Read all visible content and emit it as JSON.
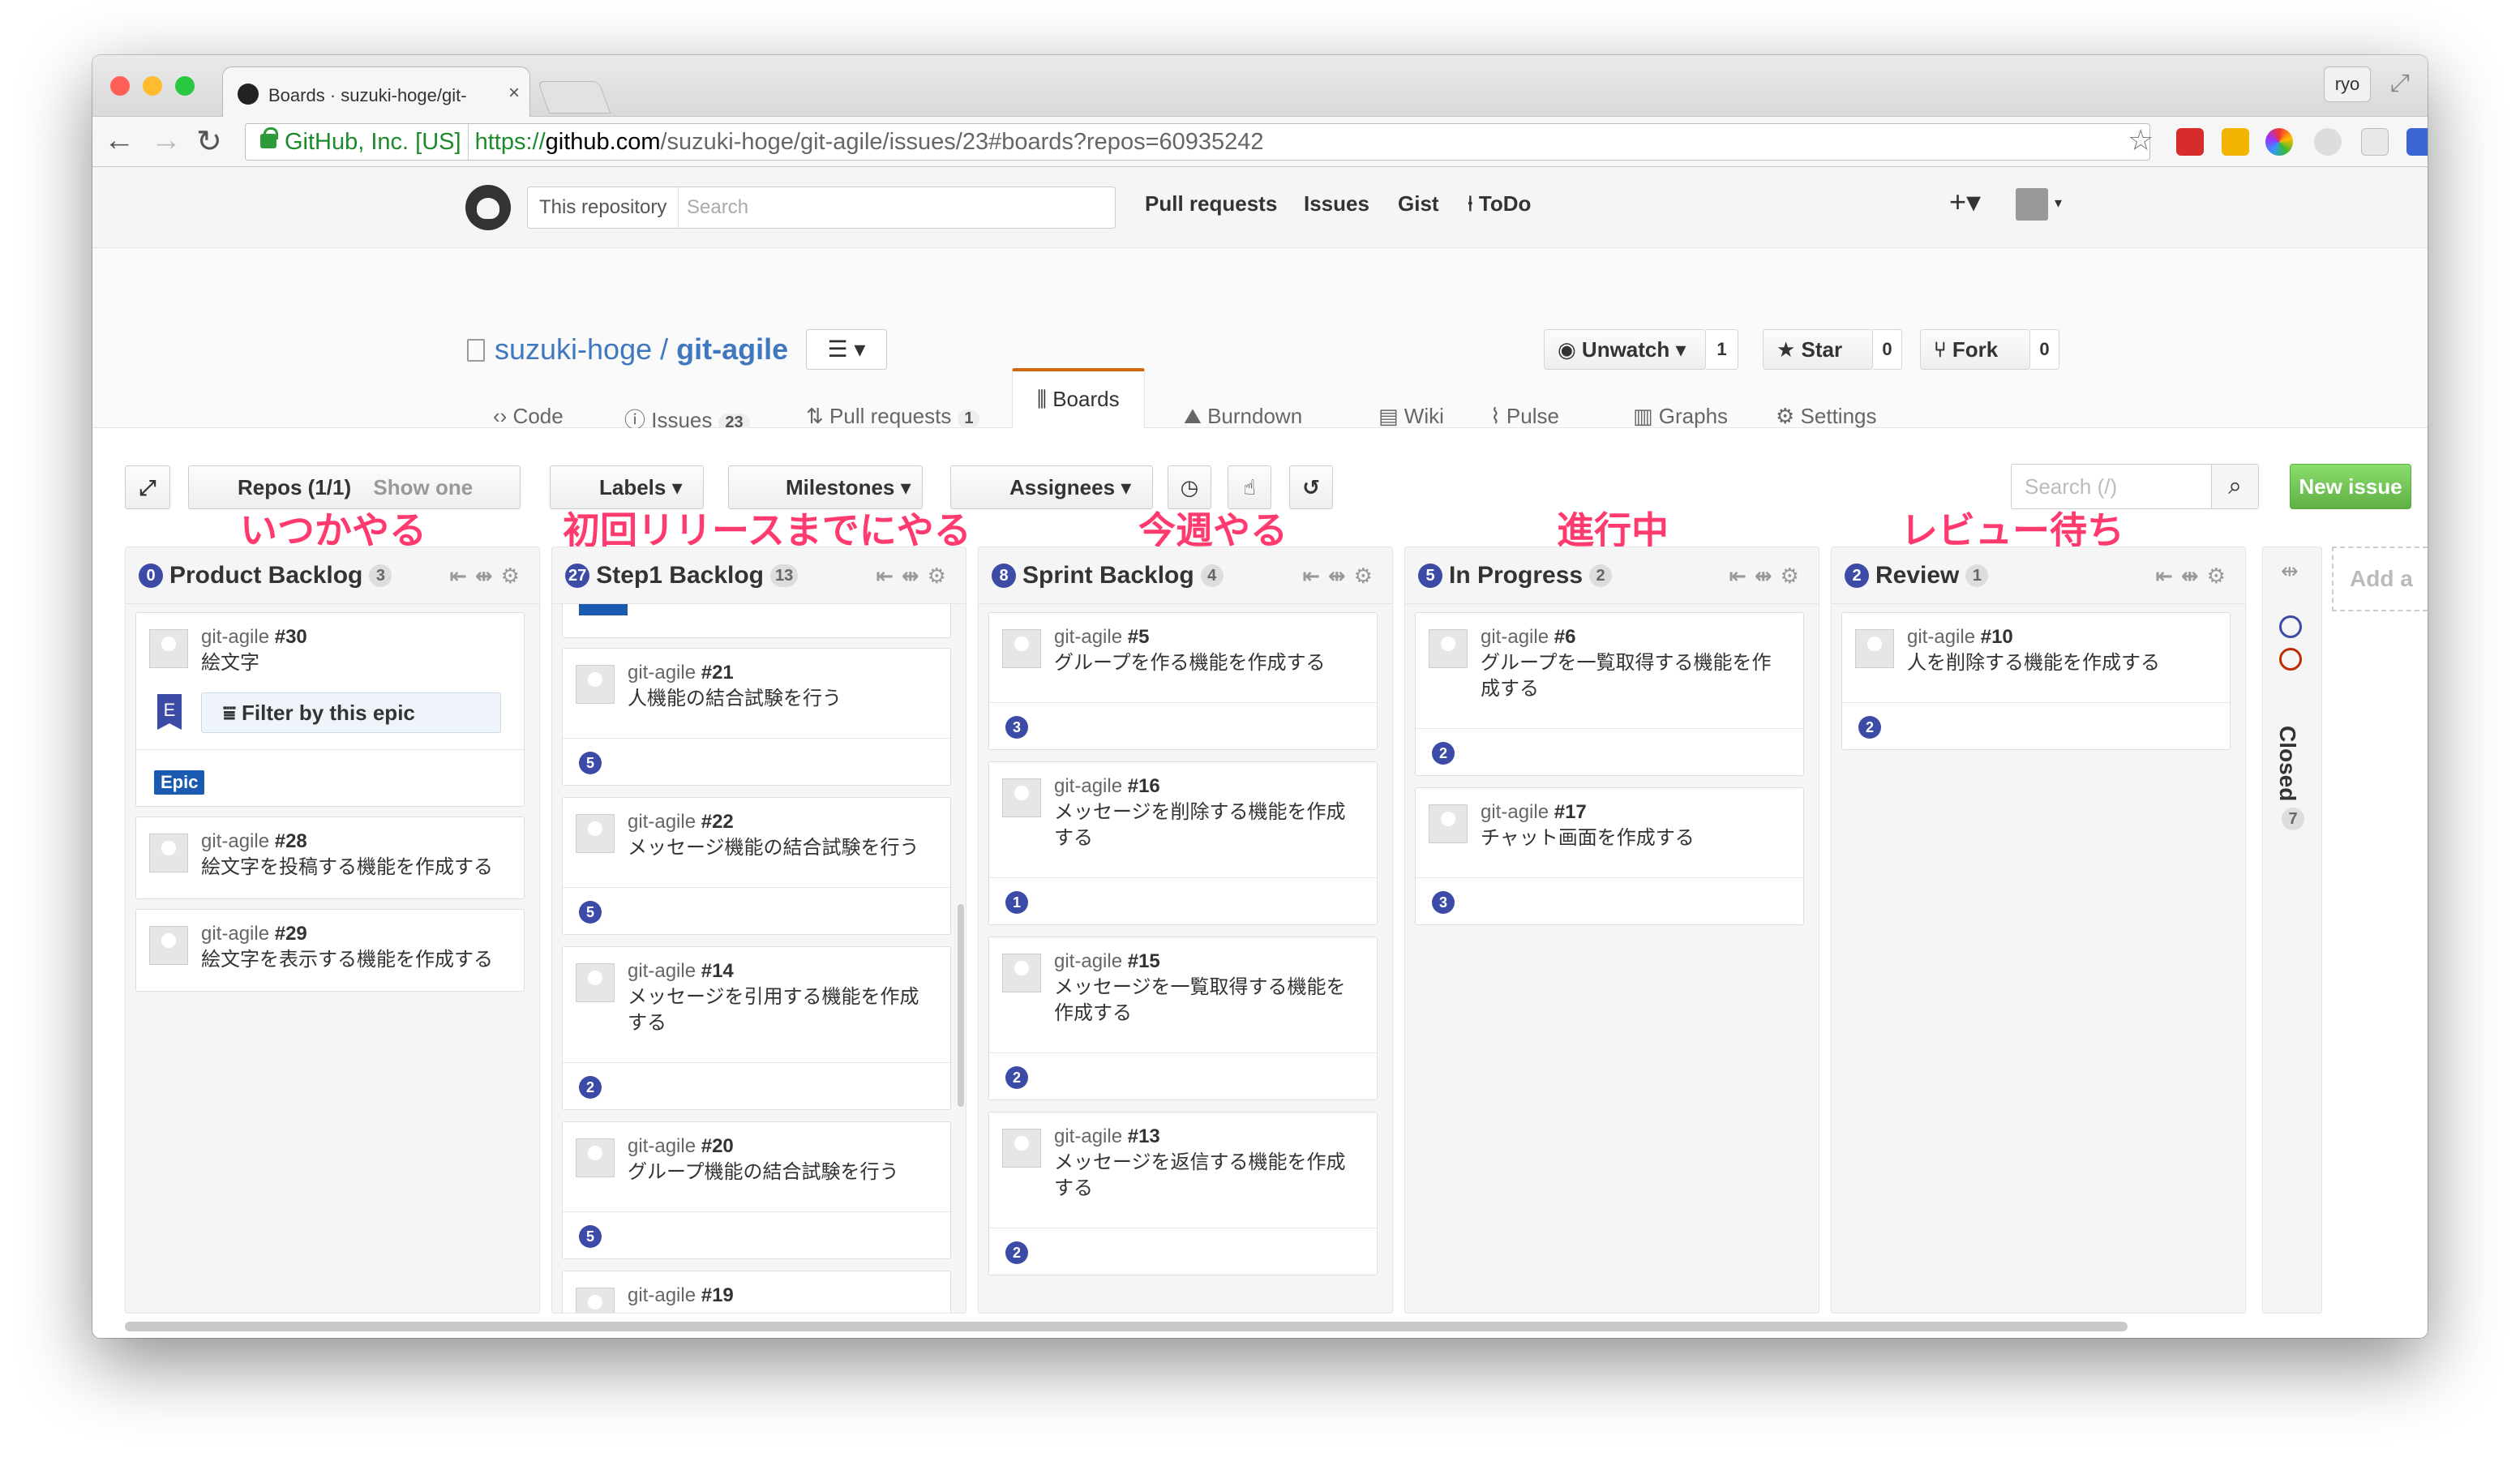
{
  "browser": {
    "tab_title": "Boards · suzuki-hoge/git-",
    "tab_close": "×",
    "user_chip": "ryo",
    "ev_cert": "GitHub, Inc. [US]",
    "url_scheme": "https://",
    "url_host": "github.com",
    "url_path": "/suzuki-hoge/git-agile/issues/23#boards?repos=60935242",
    "colors": {
      "traffic_red": "#ff5f57",
      "traffic_yellow": "#febc2e",
      "traffic_green": "#28c840"
    }
  },
  "github_header": {
    "search_scope": "This repository",
    "search_placeholder": "Search",
    "nav": [
      "Pull requests",
      "Issues",
      "Gist",
      "ToDo"
    ],
    "plus": "+▾"
  },
  "repo": {
    "owner": "suzuki-hoge",
    "separator": "/",
    "name": "git-agile",
    "list_button": "☰ ▾",
    "unwatch": {
      "label": "Unwatch ▾",
      "count": "1"
    },
    "star": {
      "label": "Star",
      "count": "0"
    },
    "fork": {
      "label": "Fork",
      "count": "0"
    },
    "tabs": [
      {
        "label": "Code",
        "icon": "code-icon"
      },
      {
        "label": "Issues",
        "count": "23",
        "icon": "issue-icon"
      },
      {
        "label": "Pull requests",
        "count": "1",
        "icon": "pr-icon"
      },
      {
        "label": "Boards",
        "icon": "boards-icon",
        "active": true
      },
      {
        "label": "Burndown",
        "icon": "burndown-icon"
      },
      {
        "label": "Wiki",
        "icon": "wiki-icon"
      },
      {
        "label": "Pulse",
        "icon": "pulse-icon"
      },
      {
        "label": "Graphs",
        "icon": "graphs-icon"
      },
      {
        "label": "Settings",
        "icon": "gear-icon"
      }
    ]
  },
  "board_toolbar": {
    "repos": "Repos (1/1)",
    "show_one": "Show one",
    "labels": "Labels ▾",
    "milestones": "Milestones ▾",
    "assignees": "Assignees ▾",
    "search_placeholder": "Search (/)",
    "new_issue": "New issue",
    "annotations": [
      "いつかやる",
      "初回リリースまでにやる",
      "今週やる",
      "進行中",
      "レビュー待ち"
    ],
    "annotation_color": "#ff3a6e"
  },
  "columns": [
    {
      "index": "0",
      "title": "Product Backlog",
      "count": "3",
      "cards": [
        {
          "repo": "git-agile",
          "number": "#30",
          "title": "絵文字",
          "epic": true,
          "filter_label": "Filter by this epic",
          "epic_flag": "E",
          "epic_tag": "Epic"
        },
        {
          "repo": "git-agile",
          "number": "#28",
          "title": "絵文字を投稿する機能を作成する"
        },
        {
          "repo": "git-agile",
          "number": "#29",
          "title": "絵文字を表示する機能を作成する"
        }
      ]
    },
    {
      "index": "27",
      "title": "Step1 Backlog",
      "count": "13",
      "cards": [
        {
          "repo": "git-agile",
          "number": "#21",
          "title": "人機能の結合試験を行う",
          "estimate": "5"
        },
        {
          "repo": "git-agile",
          "number": "#22",
          "title": "メッセージ機能の結合試験を行う",
          "estimate": "5"
        },
        {
          "repo": "git-agile",
          "number": "#14",
          "title": "メッセージを引用する機能を作成する",
          "estimate": "2"
        },
        {
          "repo": "git-agile",
          "number": "#20",
          "title": "グループ機能の結合試験を行う",
          "estimate": "5"
        },
        {
          "repo": "git-agile",
          "number": "#19",
          "title": ""
        }
      ]
    },
    {
      "index": "8",
      "title": "Sprint Backlog",
      "count": "4",
      "cards": [
        {
          "repo": "git-agile",
          "number": "#5",
          "title": "グループを作る機能を作成する",
          "estimate": "3"
        },
        {
          "repo": "git-agile",
          "number": "#16",
          "title": "メッセージを削除する機能を作成する",
          "estimate": "1"
        },
        {
          "repo": "git-agile",
          "number": "#15",
          "title": "メッセージを一覧取得する機能を作成する",
          "estimate": "2"
        },
        {
          "repo": "git-agile",
          "number": "#13",
          "title": "メッセージを返信する機能を作成する",
          "estimate": "2"
        }
      ]
    },
    {
      "index": "5",
      "title": "In Progress",
      "count": "2",
      "cards": [
        {
          "repo": "git-agile",
          "number": "#6",
          "title": "グループを一覧取得する機能を作成する",
          "estimate": "2"
        },
        {
          "repo": "git-agile",
          "number": "#17",
          "title": "チャット画面を作成する",
          "estimate": "3"
        }
      ]
    },
    {
      "index": "2",
      "title": "Review",
      "count": "1",
      "cards": [
        {
          "repo": "git-agile",
          "number": "#10",
          "title": "人を削除する機能を作成する",
          "estimate": "2"
        }
      ]
    }
  ],
  "closed_column": {
    "title": "Closed",
    "count": "7"
  },
  "add_column": "Add a"
}
